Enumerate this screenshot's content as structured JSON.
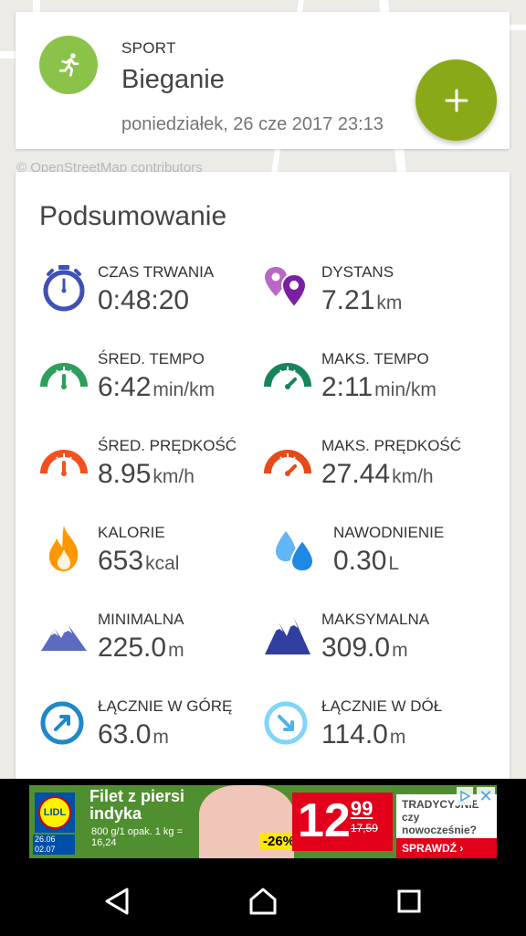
{
  "map": {
    "attribution": "© OpenStreetMap contributors"
  },
  "activity": {
    "category": "SPORT",
    "name": "Bieganie",
    "date": "poniedziałek, 26 cze 2017 23:13",
    "icon": "running-person-icon",
    "accent_color": "#8bc34a",
    "fab_color": "#8aa918",
    "fab_icon": "plus-icon"
  },
  "summary": {
    "title": "Podsumowanie",
    "stats": [
      {
        "label": "CZAS TRWANIA",
        "value": "0:48:20",
        "unit": "",
        "icon": "stopwatch-icon"
      },
      {
        "label": "DYSTANS",
        "value": "7.21",
        "unit": "km",
        "icon": "map-pins-icon"
      },
      {
        "label": "ŚRED. TEMPO",
        "value": "6:42",
        "unit": "min/km",
        "icon": "gauge-green-icon"
      },
      {
        "label": "MAKS. TEMPO",
        "value": "2:11",
        "unit": "min/km",
        "icon": "gauge-green-max-icon"
      },
      {
        "label": "ŚRED. PRĘDKOŚĆ",
        "value": "8.95",
        "unit": "km/h",
        "icon": "gauge-orange-icon"
      },
      {
        "label": "MAKS. PRĘDKOŚĆ",
        "value": "27.44",
        "unit": "km/h",
        "icon": "gauge-orange-max-icon"
      },
      {
        "label": "KALORIE",
        "value": "653",
        "unit": "kcal",
        "icon": "flame-icon"
      },
      {
        "label": "NAWODNIENIE",
        "value": "0.30",
        "unit": "L",
        "icon": "water-drops-icon"
      },
      {
        "label": "MINIMALNA",
        "value": "225.0",
        "unit": "m",
        "icon": "mountain-light-icon"
      },
      {
        "label": "MAKSYMALNA",
        "value": "309.0",
        "unit": "m",
        "icon": "mountain-dark-icon"
      },
      {
        "label": "ŁĄCZNIE W GÓRĘ",
        "value": "63.0",
        "unit": "m",
        "icon": "arrow-up-circle-icon"
      },
      {
        "label": "ŁĄCZNIE W DÓŁ",
        "value": "114.0",
        "unit": "m",
        "icon": "arrow-down-circle-icon"
      }
    ]
  },
  "ad": {
    "brand": "LIDL",
    "dates": "26.06 02.07",
    "product": "Filet z piersi indyka",
    "details": "800 g/1 opak. 1 kg = 16,24",
    "discount": "-26%",
    "price_main": "12",
    "price_cents": "99",
    "price_old": "17,59",
    "promo": "TRADYCYJNIE czy nowocześnie?",
    "cta": "SPRAWDŹ ›",
    "close": "✕"
  },
  "navbar": {
    "back": "back-icon",
    "home": "home-icon",
    "recents": "recents-icon"
  }
}
